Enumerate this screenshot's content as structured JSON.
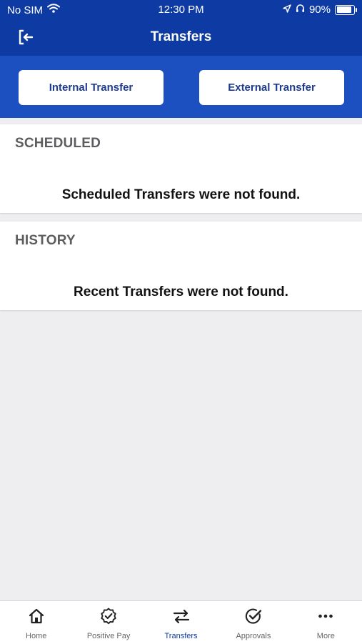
{
  "status_bar": {
    "carrier": "No SIM",
    "time": "12:30 PM",
    "battery": "90%"
  },
  "nav": {
    "title": "Transfers",
    "logout_icon": "logout-icon"
  },
  "transfer_buttons": {
    "internal_label": "Internal Transfer",
    "external_label": "External Transfer"
  },
  "scheduled": {
    "header": "SCHEDULED",
    "empty_message": "Scheduled Transfers were not found."
  },
  "history": {
    "header": "HISTORY",
    "empty_message": "Recent Transfers were not found."
  },
  "tabs": [
    {
      "label": "Home",
      "icon": "home-icon"
    },
    {
      "label": "Positive Pay",
      "icon": "badge-check-icon"
    },
    {
      "label": "Transfers",
      "icon": "transfer-arrows-icon",
      "active": true
    },
    {
      "label": "Approvals",
      "icon": "check-circle-icon"
    },
    {
      "label": "More",
      "icon": "more-icon"
    }
  ],
  "colors": {
    "brand_blue": "#0e3ba3",
    "band_blue": "#1c4fbf",
    "button_text": "#1d3a8f",
    "background": "#eeedef"
  }
}
